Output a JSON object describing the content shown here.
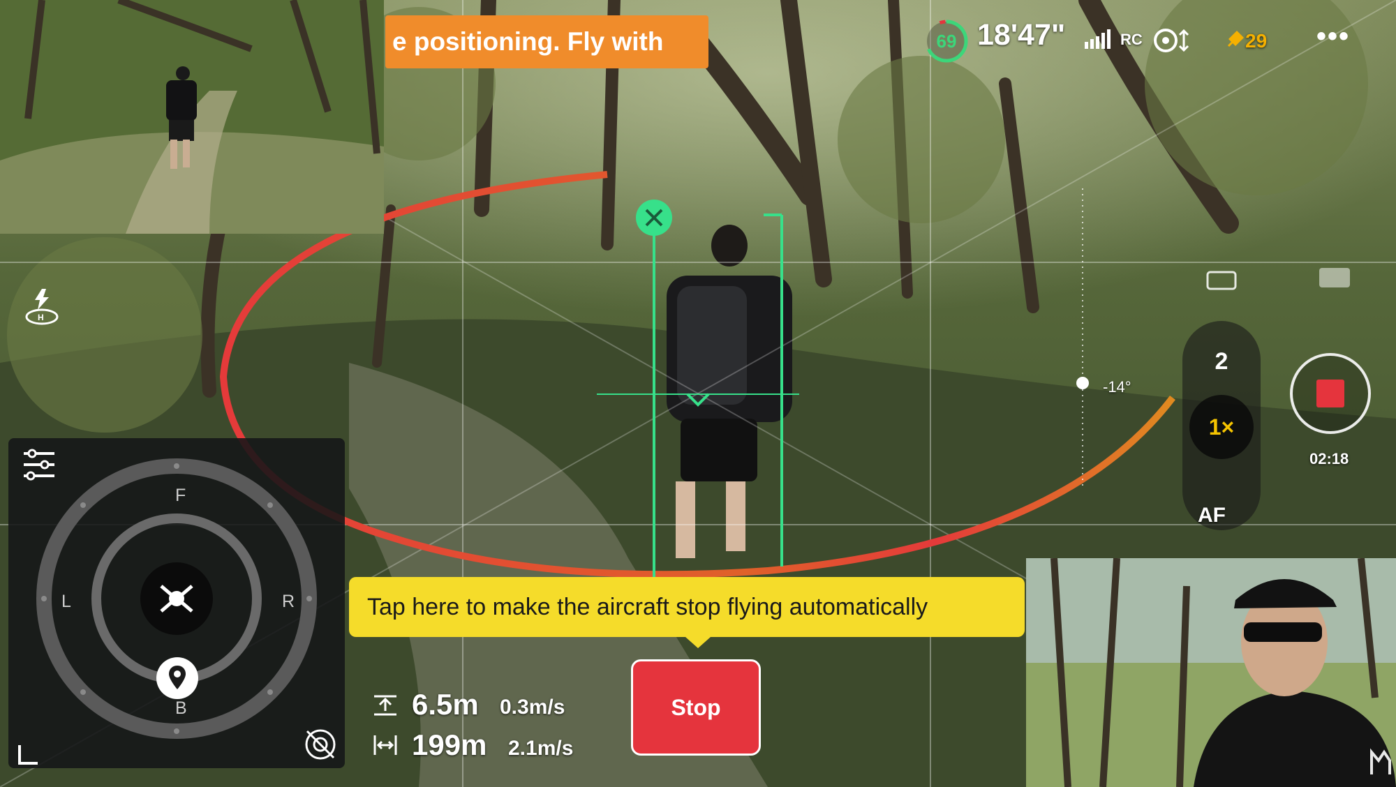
{
  "warning_banner": {
    "text": "e positioning. Fly with"
  },
  "status": {
    "battery_percent": "69",
    "flight_time": "18'47\"",
    "rc_label": "RC",
    "satellites": "29",
    "more_label": "•••"
  },
  "camera": {
    "zoom_option": "2",
    "zoom_selected": "1×",
    "focus_mode": "AF",
    "record_time": "02:18",
    "gimbal_angle": "-14°"
  },
  "minimap": {
    "front": "F",
    "back": "B",
    "left": "L",
    "right": "R"
  },
  "telemetry": {
    "altitude": "6.5m",
    "vertical_speed": "0.3m/s",
    "distance": "199m",
    "horizontal_speed": "2.1m/s"
  },
  "tooltip": {
    "text": "Tap here to make the aircraft stop flying automatically"
  },
  "stop_button": {
    "label": "Stop"
  },
  "colors": {
    "accent_green": "#3cd67a",
    "warning_orange": "#f08c2b",
    "tooltip_yellow": "#f5dc2a",
    "stop_red": "#e5343d",
    "orbit_red": "#e53a3a"
  }
}
